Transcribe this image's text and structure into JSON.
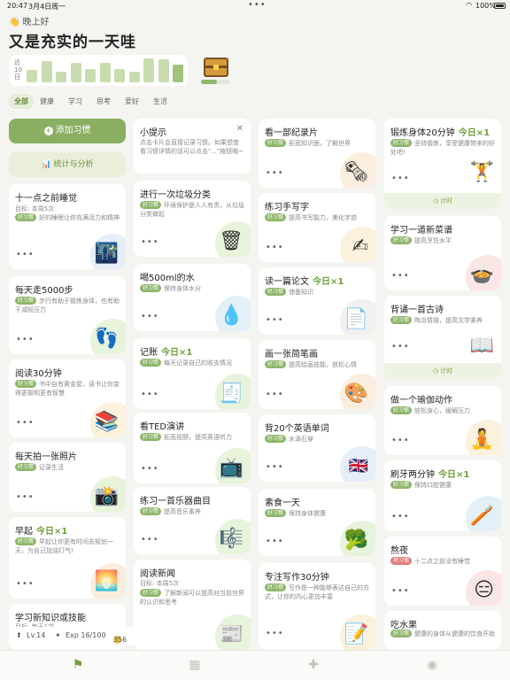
{
  "status_bar": {
    "time": "20:47",
    "date": "3月4日周一",
    "battery": "100%"
  },
  "greeting": "晚上好",
  "headline": "又是充实的一天哇",
  "week_chart": {
    "label": "近10日",
    "values": [
      0.5,
      0.9,
      0.45,
      0.8,
      0.55,
      0.8,
      0.55,
      0.45,
      1.0,
      0.95,
      0.75
    ]
  },
  "level_progress": 0.55,
  "tabs": [
    "全部",
    "健康",
    "学习",
    "思考",
    "爱好",
    "生活"
  ],
  "actions": {
    "add_habit": "添加习惯",
    "stats": "统计与分析"
  },
  "more_glyph": "•••",
  "timer_label": "计时",
  "today_label": "今日×1",
  "good_tag": "好习惯",
  "bad_tag": "坏习惯",
  "cards": {
    "c1": {
      "title": "十一点之前睡觉",
      "target": "目标: 本周5次",
      "desc": "好的睡眠让你充满活力和精神"
    },
    "c2": {
      "title": "每天走5000步",
      "desc": "步行有助于锻炼身体，也有助于减轻压力"
    },
    "c3": {
      "title": "阅读30分钟",
      "desc": "书中自有黄金屋，读书让你变得更聪明更有智慧"
    },
    "c4": {
      "title": "每天拍一张照片",
      "desc": "记录生活"
    },
    "c5": {
      "title": "早起",
      "desc": "早起让你更有时间去规划一天，为自己加油打气!"
    },
    "c6": {
      "title": "学习新知识或技能",
      "target": "目标: 每天1次"
    },
    "tip": {
      "title": "小提示",
      "desc": "点击卡片会直接记录习惯。如果想查看习惯详情的话可以点击\"...\"按钮哦~"
    },
    "d2": {
      "title": "进行一次垃圾分类",
      "desc": "环境保护是人人有责，从垃圾分类做起"
    },
    "d3": {
      "title": "喝500ml的水",
      "desc": "保持身体水分"
    },
    "d4": {
      "title": "记账",
      "desc": "每天记录自己的收支情况"
    },
    "d5": {
      "title": "看TED演讲",
      "desc": "拓宽视野，提高英语听力"
    },
    "d6": {
      "title": "练习一首乐器曲目",
      "desc": "提高音乐素养"
    },
    "d7": {
      "title": "阅读新闻",
      "target": "目标: 本周5次",
      "desc": "了解新闻可以提高对当前世界的认识和思考"
    },
    "e1": {
      "title": "看一部纪录片",
      "desc": "拓宽知识面，了解世界"
    },
    "e2": {
      "title": "练习手写字",
      "desc": "提高书写能力，美化字迹"
    },
    "e3": {
      "title": "读一篇论文",
      "desc": "储备知识"
    },
    "e4": {
      "title": "画一张简笔画",
      "desc": "提高绘画技能，放松心情"
    },
    "e5": {
      "title": "背20个英语单词",
      "desc": "水滴石穿"
    },
    "e6": {
      "title": "素食一天",
      "desc": "保持身体健康"
    },
    "e7": {
      "title": "专注写作30分钟",
      "desc": "写作是一种能够表达自己的方式，让你的内心更加丰富"
    },
    "f1": {
      "title": "锻炼身体20分钟",
      "desc": "坚持锻炼，享受健康带来的好处吧!"
    },
    "f2": {
      "title": "学习一道新菜谱",
      "desc": "提高烹饪水平"
    },
    "f3": {
      "title": "背诵一首古诗",
      "desc": "陶冶情操，提高文学素养"
    },
    "f4": {
      "title": "做一个瑜伽动作",
      "desc": "放松身心，缓解压力"
    },
    "f5": {
      "title": "刷牙两分钟",
      "desc": "保持口腔健康"
    },
    "f6": {
      "title": "熬夜",
      "desc": "十二点之前没有睡觉"
    },
    "f7": {
      "title": "吃水果",
      "desc": "健康的身体从健康的饮食开始"
    }
  },
  "stats": {
    "level": "Lv.14",
    "exp": "Exp 16/100",
    "coins": "356"
  }
}
